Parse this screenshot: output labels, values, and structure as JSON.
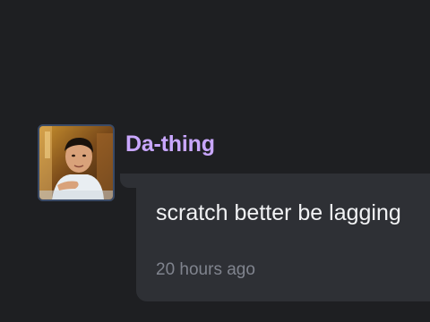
{
  "post": {
    "username": "Da-thing",
    "message": "scratch better be lagging",
    "timestamp": "20 hours ago",
    "avatar_icon": "user-photo-avatar"
  },
  "colors": {
    "background": "#1e1f22",
    "bubble": "#2e3035",
    "username": "#c9a7ff",
    "message_text": "#f2f3f5",
    "timestamp_text": "#80848e",
    "avatar_border": "#3a4a66"
  }
}
